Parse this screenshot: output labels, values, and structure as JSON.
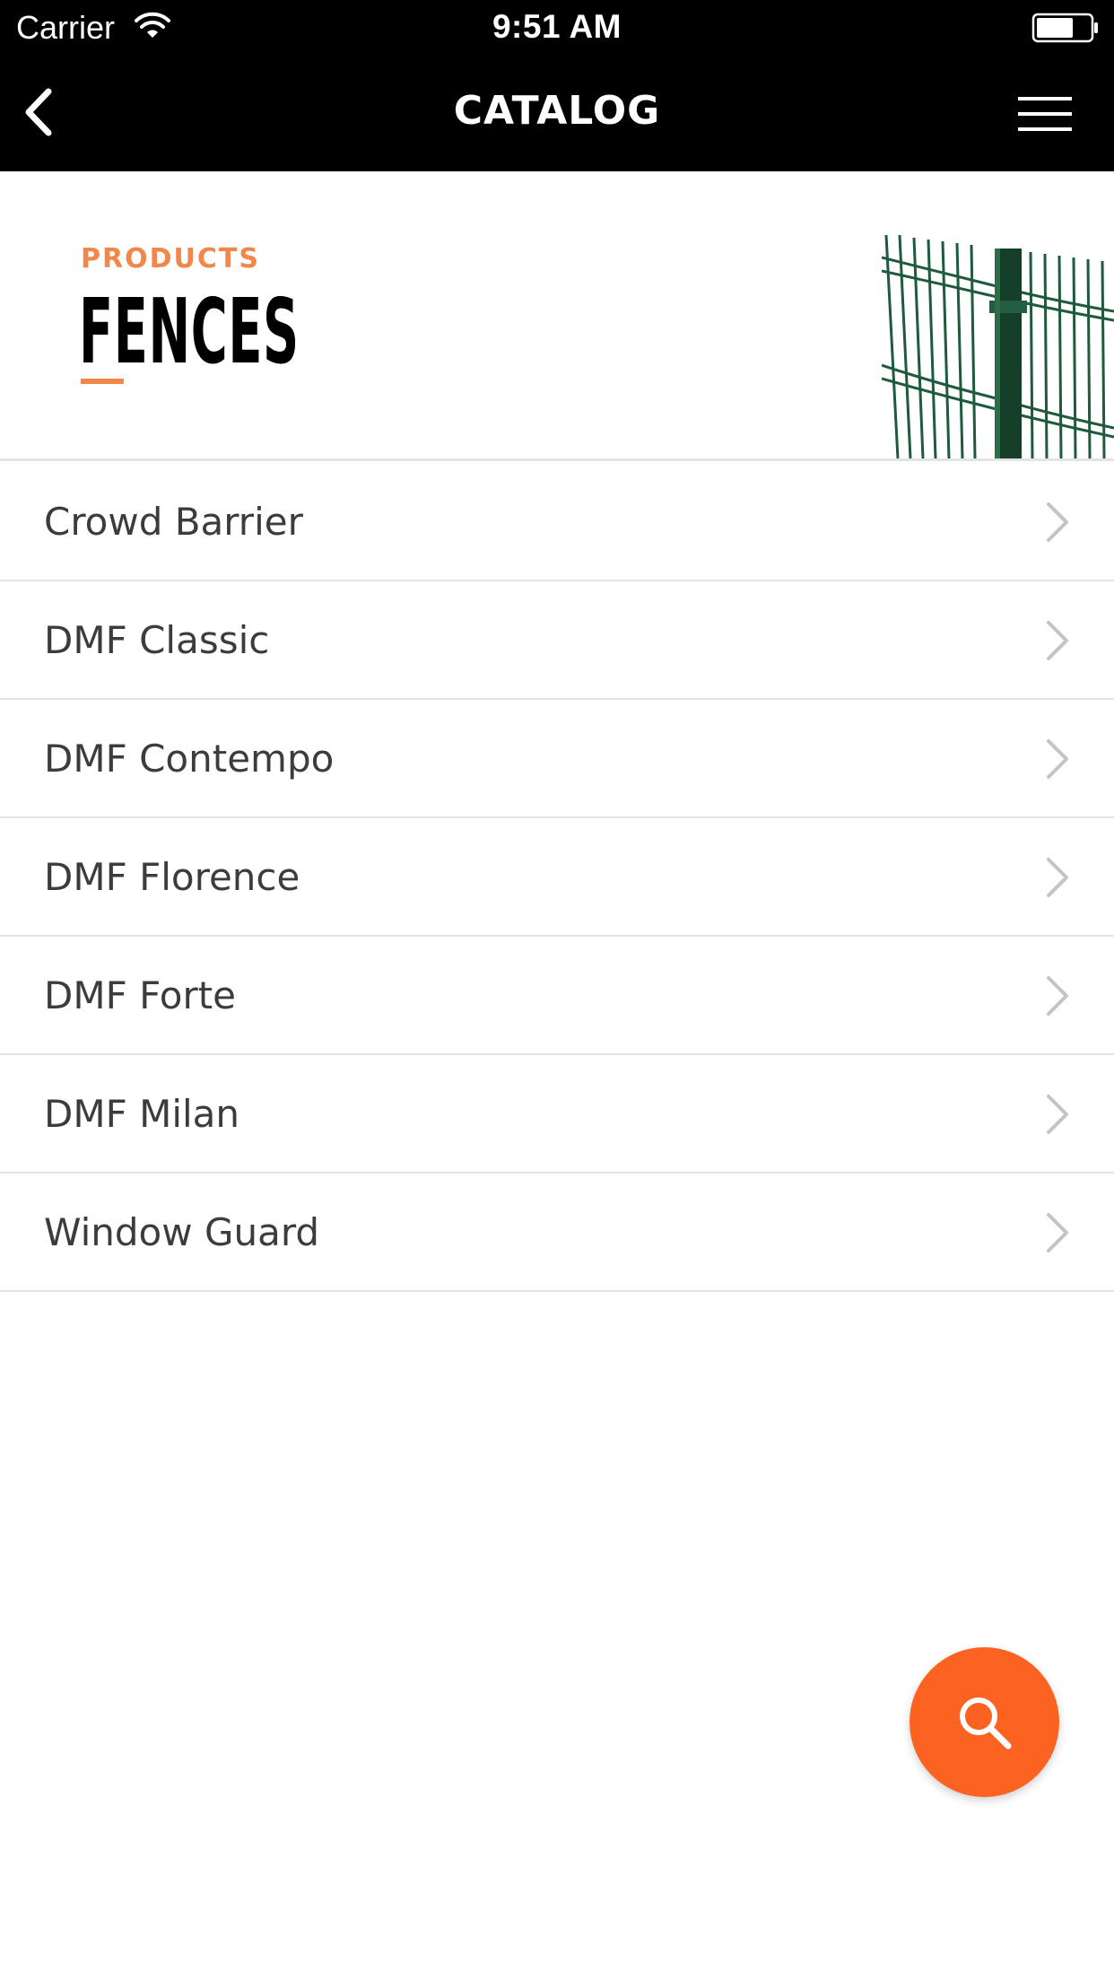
{
  "status_bar": {
    "carrier": "Carrier",
    "time": "9:51 AM"
  },
  "nav": {
    "title": "CATALOG",
    "back_icon": "chevron-left-icon",
    "menu_icon": "hamburger-menu-icon"
  },
  "header": {
    "category": "PRODUCTS",
    "title": "FENCES",
    "accent_color": "#f2874c"
  },
  "products": [
    {
      "label": "Crowd Barrier"
    },
    {
      "label": "DMF Classic"
    },
    {
      "label": "DMF Contempo"
    },
    {
      "label": "DMF Florence"
    },
    {
      "label": "DMF Forte"
    },
    {
      "label": "DMF Milan"
    },
    {
      "label": "Window Guard"
    }
  ],
  "fab": {
    "icon": "search-icon",
    "color": "#fc6320"
  }
}
